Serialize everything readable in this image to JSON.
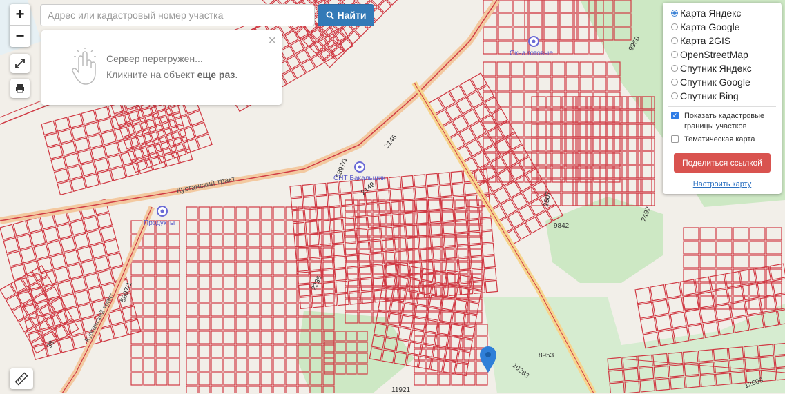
{
  "search": {
    "placeholder": "Адрес или кадастровый номер участка",
    "find_label": "Найти"
  },
  "zoom": {
    "in": "+",
    "out": "−"
  },
  "popup": {
    "line1": "Сервер перегружен...",
    "line2_prefix": "Кликните на объект ",
    "line2_bold": "еще раз",
    "line2_suffix": ".",
    "close": "×"
  },
  "layers": {
    "options": [
      {
        "label": "Карта Яндекс",
        "selected": true
      },
      {
        "label": "Карта Google",
        "selected": false
      },
      {
        "label": "Карта 2GIS",
        "selected": false
      },
      {
        "label": "OpenStreetMap",
        "selected": false
      },
      {
        "label": "Спутник Яндекс",
        "selected": false
      },
      {
        "label": "Спутник Google",
        "selected": false
      },
      {
        "label": "Спутник Bing",
        "selected": false
      }
    ],
    "show_cadastral": "Показать кадастровые границы участков",
    "show_cadastral_checked": true,
    "thematic": "Тематическая карта",
    "thematic_checked": false,
    "share_label": "Поделиться ссылкой",
    "configure_label": "Настроить карту"
  },
  "map": {
    "pois": {
      "okna": "Окна готовые",
      "snt": "СНТ Бакальщик",
      "produkty": "Продукты"
    },
    "roads": {
      "trakt": "Курганский тракт",
      "trakt2": "Курганский тракт"
    },
    "parcel_labels": [
      "9960",
      "9960",
      "9842",
      "8953",
      "2492",
      "2507",
      "10263",
      "11921",
      "12609",
      "2236",
      "5897/1",
      "2149",
      "2146",
      "5897/1",
      "38"
    ],
    "colors": {
      "parcel": "#d03a44",
      "green": "#c9e6c1",
      "road": "#f6d58e",
      "bg": "#f2efe9"
    }
  }
}
